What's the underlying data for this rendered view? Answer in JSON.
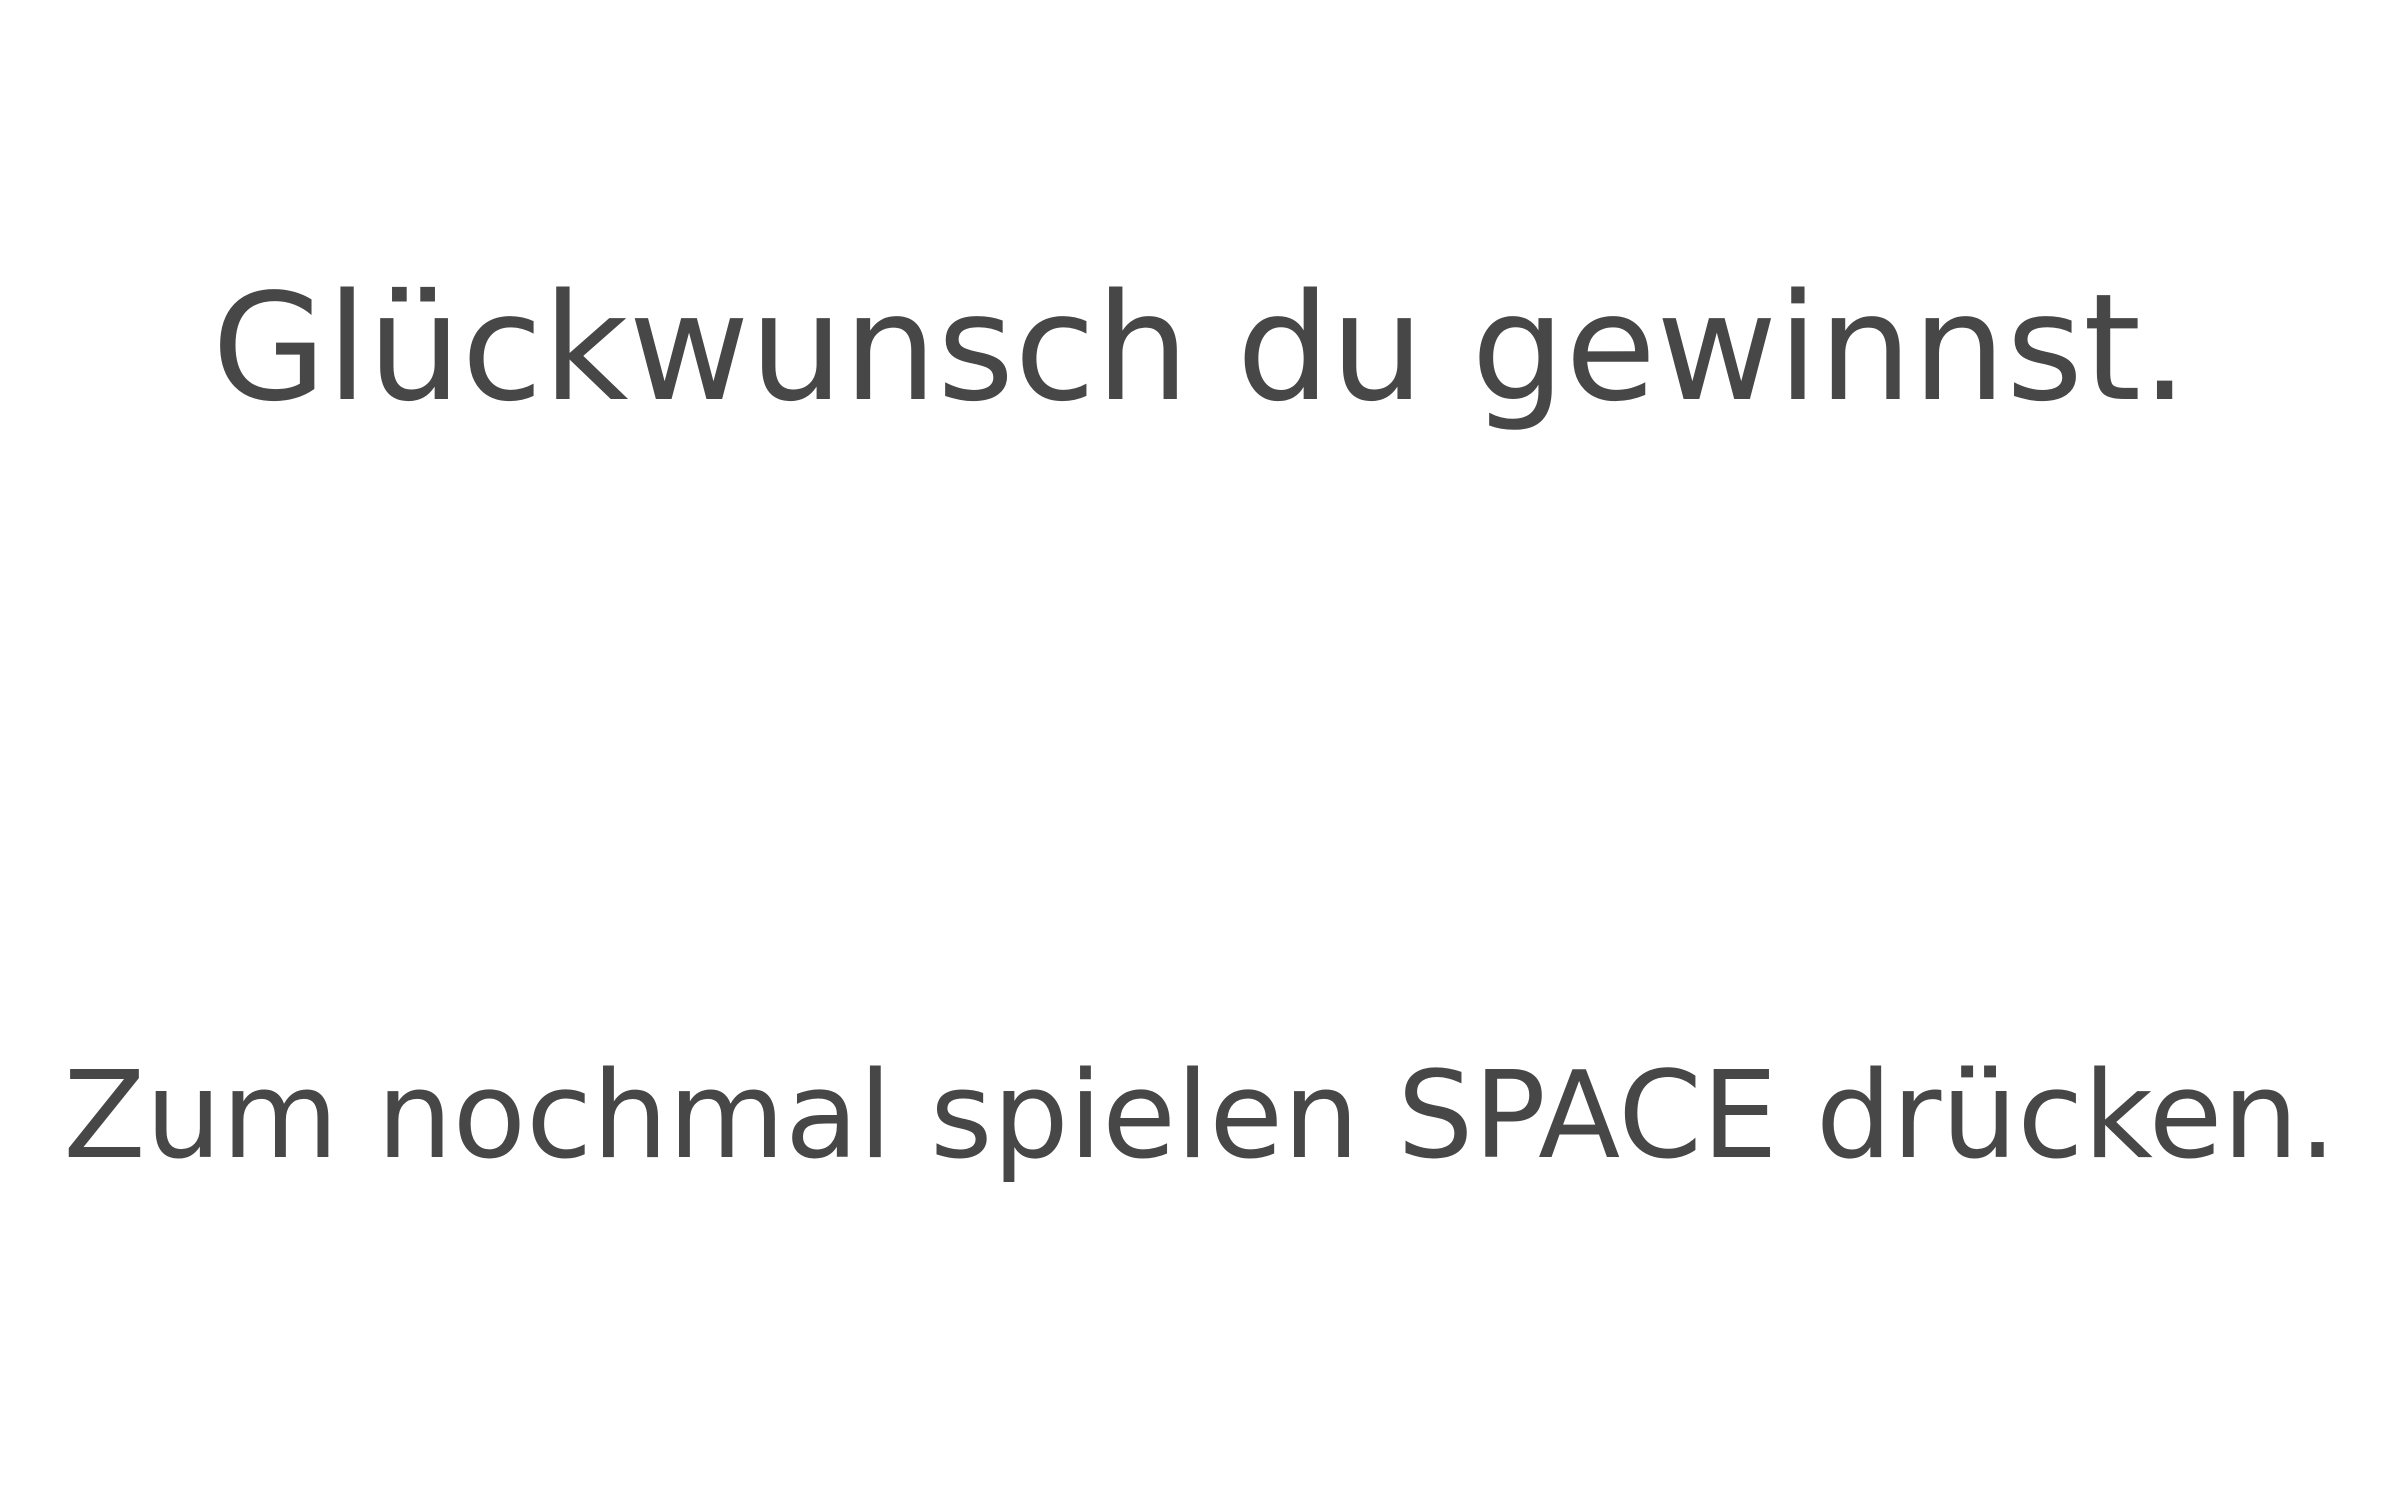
{
  "game": {
    "win_message": "Glückwunsch du gewinnst.",
    "restart_hint": "Zum nochmal spielen SPACE drücken."
  },
  "colors": {
    "background": "#ffffff",
    "text": "#474747"
  }
}
